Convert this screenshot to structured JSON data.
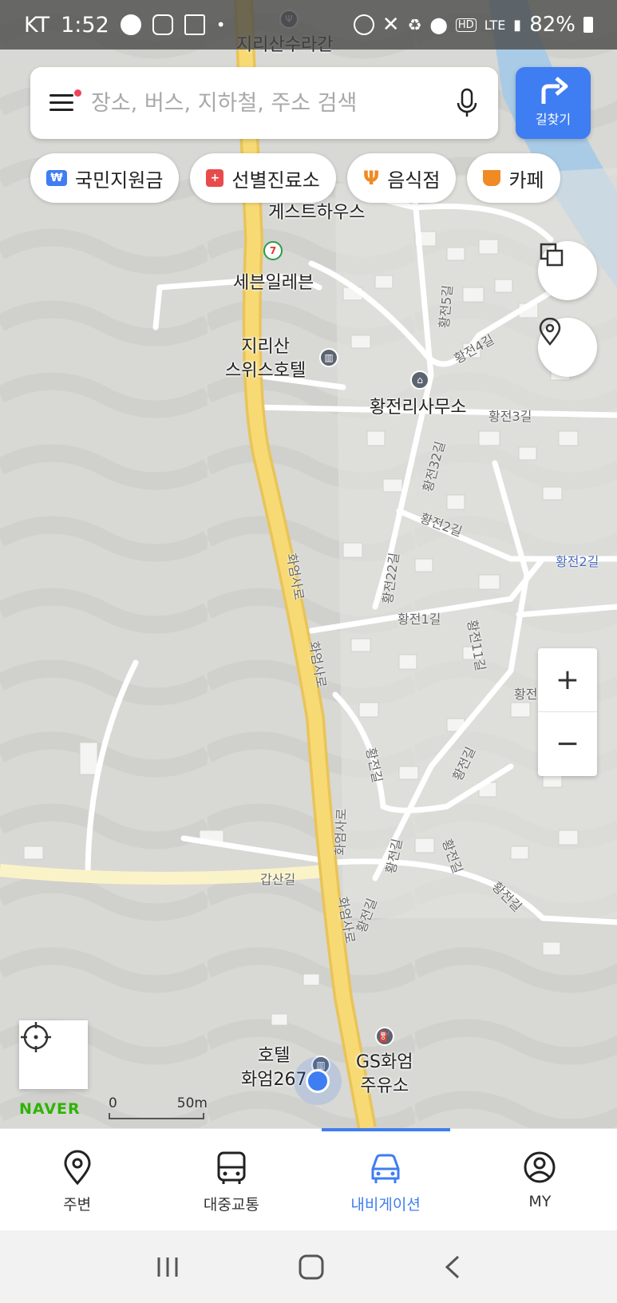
{
  "status": {
    "carrier": "KT",
    "time": "1:52",
    "network": "LTE",
    "battery": "82%"
  },
  "search": {
    "placeholder": "장소, 버스, 지하철, 주소 검색",
    "route_label": "길찾기"
  },
  "chips": [
    {
      "label": "국민지원금",
      "icon": "won-card-icon",
      "color": "#3f7df2"
    },
    {
      "label": "선별진료소",
      "icon": "medical-cross-icon",
      "color": "#e94b4b"
    },
    {
      "label": "음식점",
      "icon": "fork-knife-icon",
      "color": "#f08a24"
    },
    {
      "label": "카페",
      "icon": "coffee-cup-icon",
      "color": "#f08a24"
    }
  ],
  "map": {
    "places": {
      "top_restaurant": "지리산수라간",
      "guesthouse": "게스트하우스",
      "seven_eleven": "세븐일레븐",
      "hotel_swiss": "지리산\n스위스호텔",
      "village_office": "황전리사무소",
      "hotel_hwaeom": "호텔\n화엄267",
      "gas_station": "GS화엄\n주유소"
    },
    "roads": {
      "hwaeomsa_1": "화엄사로",
      "hwaeomsa_2": "화엄사로",
      "hwaeomsa_3": "화엄사로",
      "hwaeomsa_4": "화엄사로",
      "gapsan": "갑산길",
      "hwangjeon_1": "황전1길",
      "hwangjeon_2": "황전2길",
      "hwangjeon_2_right": "황전2길",
      "hwangjeon_3": "황전3길",
      "hwangjeon_4": "황전4길",
      "hwangjeon_5": "황전5길",
      "hwangjeon_11": "황전11길",
      "hwangjeon_22": "황전22길",
      "hwangjeon_32": "황전32길",
      "hwangjeon_a": "황전길",
      "hwangjeon_b": "황전길",
      "hwangjeon_c": "황전길",
      "hwangjeon_d": "황전길",
      "hwangjeon_e": "황전길",
      "hwangjeon_f": "황전길",
      "hwangjeon_g": "황전길"
    },
    "logo": "NAVER",
    "scale_zero": "0",
    "scale_label": "50m"
  },
  "zoom": {
    "in": "+",
    "out": "−"
  },
  "tabs": [
    {
      "label": "주변",
      "icon": "nearby-pin-icon",
      "active": false
    },
    {
      "label": "대중교통",
      "icon": "bus-icon",
      "active": false
    },
    {
      "label": "내비게이션",
      "icon": "car-icon",
      "active": true
    },
    {
      "label": "MY",
      "icon": "profile-icon",
      "active": false
    }
  ],
  "colors": {
    "accent": "#3f7df2",
    "main_road": "#f5d56e",
    "river": "#a9cbe6",
    "naver": "#2db400"
  }
}
